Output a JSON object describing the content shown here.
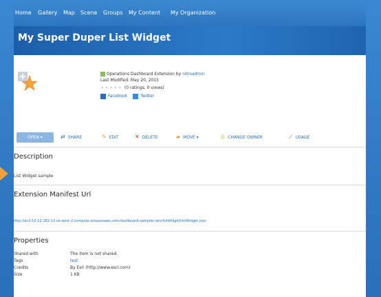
{
  "nav": {
    "items": [
      "Home",
      "Gallery",
      "Map",
      "Scene",
      "Groups",
      "My Content",
      "My Organization"
    ]
  },
  "page": {
    "title": "My Super Duper List Widget"
  },
  "item": {
    "type_line": "Operations Dashboard Extension by",
    "owner": "nitroadmin",
    "last_modified": "Last Modified: May 20, 2015",
    "ratings": "(0 ratings, 0 views)",
    "facebook": "Facebook",
    "twitter": "Twitter"
  },
  "toolbar": {
    "open": "OPEN ▾",
    "share": "SHARE",
    "edit": "EDIT",
    "delete": "DELETE",
    "move": "MOVE ▾",
    "change_owner": "CHANGE OWNER",
    "usage": "USAGE"
  },
  "description": {
    "title": "Description",
    "text": "List Widget sample"
  },
  "manifest": {
    "title": "Extension Manifest Url",
    "url": "http://ec2-52-12-182-13.us-west-2.compute.amazonaws.com/dashboard-samples-dev/listWidget/listWidget.json"
  },
  "properties": {
    "title": "Properties",
    "rows": [
      {
        "key": "Shared with",
        "value": "The item is not shared."
      },
      {
        "key": "Tags",
        "value": "test"
      },
      {
        "key": "Credits",
        "value": "By Esri (http://www.esri.com)"
      },
      {
        "key": "Size",
        "value": "1 KB"
      }
    ]
  },
  "colors": {
    "accent": "#2a6fb8",
    "link": "#1d6fbf",
    "open_button": "#8cb5e2",
    "delete": "#d9332b"
  }
}
